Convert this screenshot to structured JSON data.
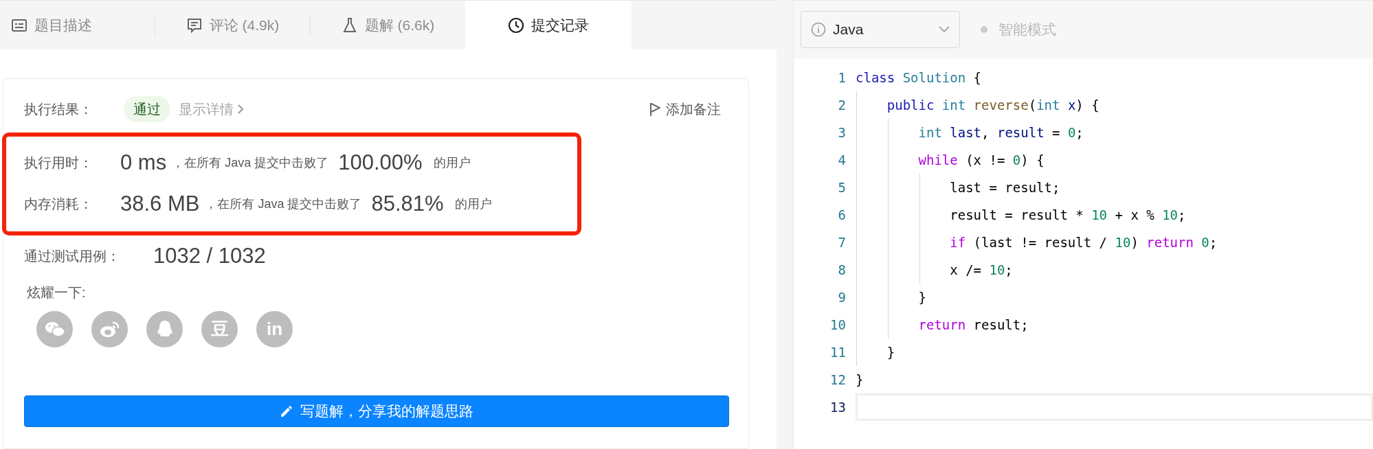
{
  "tabs": [
    {
      "label": "题目描述",
      "kind": "description",
      "selected": false
    },
    {
      "label": "评论 (4.9k)",
      "kind": "comments",
      "selected": false
    },
    {
      "label": "题解 (6.6k)",
      "kind": "solutions",
      "selected": false
    },
    {
      "label": "提交记录",
      "kind": "submissions",
      "selected": true
    }
  ],
  "result": {
    "label": "执行结果：",
    "status": "通过",
    "details_link": "显示详情",
    "note_button": "添加备注"
  },
  "stats_highlighted": true,
  "stats": [
    {
      "label": "执行用时：",
      "value": "0 ms",
      "middle": "，在所有 Java 提交中击败了",
      "percent": "100.00%",
      "suffix": "的用户"
    },
    {
      "label": "内存消耗：",
      "value": "38.6 MB",
      "middle": "，在所有 Java 提交中击败了",
      "percent": "85.81%",
      "suffix": "的用户"
    }
  ],
  "tests": {
    "label": "通过测试用例：",
    "value": "1032 / 1032"
  },
  "share": {
    "label": "炫耀一下:",
    "buttons": [
      {
        "kind": "wechat"
      },
      {
        "kind": "weibo"
      },
      {
        "kind": "qq"
      },
      {
        "kind": "douban",
        "label": "豆"
      },
      {
        "kind": "linkedin",
        "label": "in"
      }
    ]
  },
  "write_button": "写题解，分享我的解题思路",
  "editor": {
    "language": "Java",
    "mode": "智能模式",
    "lines": [
      {
        "number": "1",
        "active": false,
        "tokens": [
          {
            "text": "class",
            "kind": "keyword"
          },
          {
            "text": " Solution",
            "kind": "type"
          },
          {
            "text": " {",
            "kind": "plain"
          }
        ]
      },
      {
        "number": "2",
        "active": false,
        "tokens": [
          {
            "text": "    public",
            "kind": "keyword"
          },
          {
            "text": " int",
            "kind": "type"
          },
          {
            "text": " reverse",
            "kind": "function"
          },
          {
            "text": "(",
            "kind": "plain"
          },
          {
            "text": "int",
            "kind": "type"
          },
          {
            "text": " x",
            "kind": "variable"
          },
          {
            "text": ") {",
            "kind": "plain"
          }
        ]
      },
      {
        "number": "3",
        "active": false,
        "tokens": [
          {
            "text": "        int",
            "kind": "type"
          },
          {
            "text": " last",
            "kind": "variable"
          },
          {
            "text": ", ",
            "kind": "plain"
          },
          {
            "text": "result",
            "kind": "variable"
          },
          {
            "text": " = ",
            "kind": "plain"
          },
          {
            "text": "0",
            "kind": "number"
          },
          {
            "text": ";",
            "kind": "plain"
          }
        ]
      },
      {
        "number": "4",
        "active": false,
        "tokens": [
          {
            "text": "        while",
            "kind": "control"
          },
          {
            "text": " (x != ",
            "kind": "plain"
          },
          {
            "text": "0",
            "kind": "number"
          },
          {
            "text": ") {",
            "kind": "plain"
          }
        ]
      },
      {
        "number": "5",
        "active": false,
        "tokens": [
          {
            "text": "            last = result;",
            "kind": "plain"
          }
        ]
      },
      {
        "number": "6",
        "active": false,
        "tokens": [
          {
            "text": "            result = result * ",
            "kind": "plain"
          },
          {
            "text": "10",
            "kind": "number"
          },
          {
            "text": " + x % ",
            "kind": "plain"
          },
          {
            "text": "10",
            "kind": "number"
          },
          {
            "text": ";",
            "kind": "plain"
          }
        ]
      },
      {
        "number": "7",
        "active": false,
        "tokens": [
          {
            "text": "            if",
            "kind": "control"
          },
          {
            "text": " (last != result / ",
            "kind": "plain"
          },
          {
            "text": "10",
            "kind": "number"
          },
          {
            "text": ") ",
            "kind": "plain"
          },
          {
            "text": "return",
            "kind": "control"
          },
          {
            "text": " 0",
            "kind": "number"
          },
          {
            "text": ";",
            "kind": "plain"
          }
        ]
      },
      {
        "number": "8",
        "active": false,
        "tokens": [
          {
            "text": "            x /= ",
            "kind": "plain"
          },
          {
            "text": "10",
            "kind": "number"
          },
          {
            "text": ";",
            "kind": "plain"
          }
        ]
      },
      {
        "number": "9",
        "active": false,
        "tokens": [
          {
            "text": "        }",
            "kind": "plain"
          }
        ]
      },
      {
        "number": "10",
        "active": false,
        "tokens": [
          {
            "text": "        return",
            "kind": "control"
          },
          {
            "text": " result;",
            "kind": "plain"
          }
        ]
      },
      {
        "number": "11",
        "active": false,
        "tokens": [
          {
            "text": "    }",
            "kind": "plain"
          }
        ]
      },
      {
        "number": "12",
        "active": false,
        "tokens": [
          {
            "text": "}",
            "kind": "plain"
          }
        ]
      },
      {
        "number": "13",
        "active": true
      }
    ]
  }
}
